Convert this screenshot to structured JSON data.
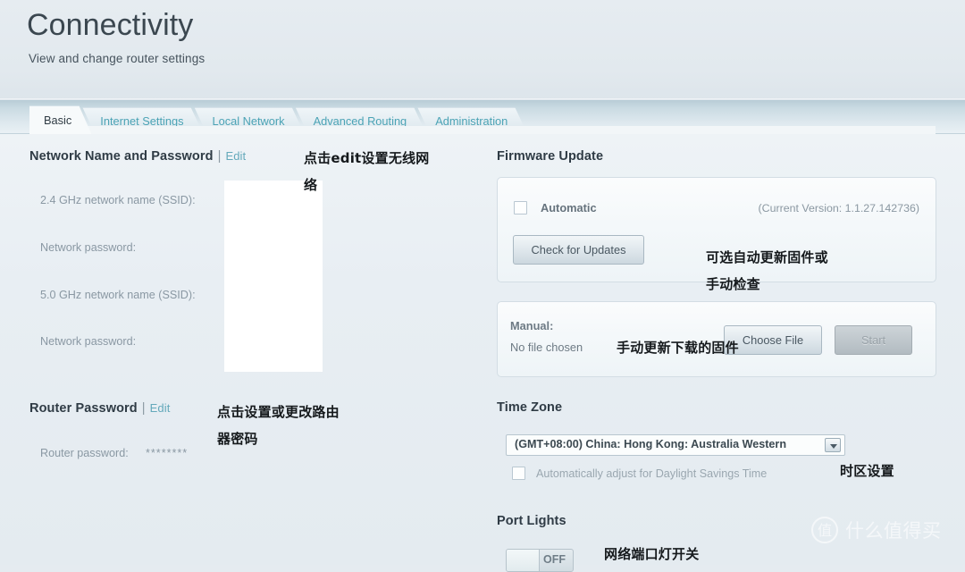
{
  "header": {
    "title": "Connectivity",
    "subtitle": "View and change router settings"
  },
  "tabs": [
    {
      "label": "Basic",
      "active": true
    },
    {
      "label": "Internet Settings",
      "active": false
    },
    {
      "label": "Local Network",
      "active": false
    },
    {
      "label": "Advanced Routing",
      "active": false
    },
    {
      "label": "Administration",
      "active": false
    }
  ],
  "network_section": {
    "title": "Network Name and Password",
    "separator": "|",
    "edit_label": "Edit",
    "fields": [
      {
        "label": "2.4 GHz network name (SSID):",
        "value": ""
      },
      {
        "label": "Network password:",
        "value": ""
      },
      {
        "label": "5.0 GHz network name (SSID):",
        "value": ""
      },
      {
        "label": "Network password:",
        "value": ""
      }
    ]
  },
  "router_password_section": {
    "title": "Router Password",
    "separator": "|",
    "edit_label": "Edit",
    "field_label": "Router password:",
    "field_value": "********"
  },
  "firmware_section": {
    "title": "Firmware Update",
    "automatic_label": "Automatic",
    "automatic_checked": false,
    "current_version": "(Current Version: 1.1.27.142736)",
    "check_updates_button": "Check for Updates",
    "manual_label": "Manual:",
    "no_file_text": "No file chosen",
    "choose_file_button": "Choose File",
    "start_button": "Start",
    "start_disabled": true
  },
  "timezone_section": {
    "title": "Time Zone",
    "selected_option": "(GMT+08:00) China: Hong Kong: Australia Western",
    "dst_label": "Automatically adjust for Daylight Savings Time",
    "dst_checked": false
  },
  "port_lights_section": {
    "title": "Port Lights",
    "toggle_state": "OFF"
  },
  "annotations": [
    {
      "id": "wireless-edit-note",
      "text": "点击edit设置无线网\n络"
    },
    {
      "id": "router-password-note",
      "text": "点击设置或更改路由\n器密码"
    },
    {
      "id": "firmware-auto-note",
      "text": "可选自动更新固件或\n手动检查"
    },
    {
      "id": "firmware-manual-note",
      "text": "手动更新下载的固件"
    },
    {
      "id": "timezone-note",
      "text": "时区设置"
    },
    {
      "id": "port-lights-note",
      "text": "网络端口灯开关"
    }
  ],
  "watermark": {
    "logo_char": "值",
    "text": "什么值得买"
  },
  "colors": {
    "link": "#64a9bb",
    "tab_inactive_text": "#4ba3b5",
    "heading": "#2f3b45",
    "muted": "#8a98a3",
    "page_bg": "#e5ebf0"
  }
}
